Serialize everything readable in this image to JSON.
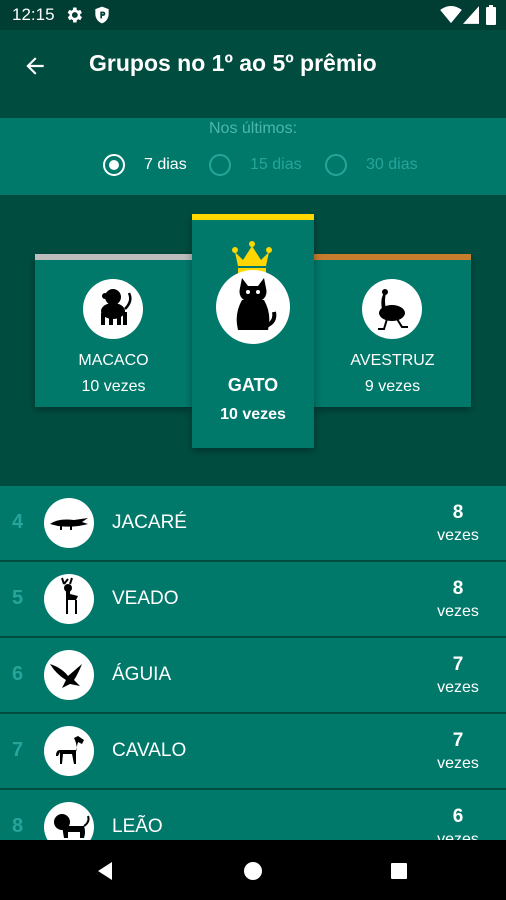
{
  "status": {
    "time": "12:15"
  },
  "header": {
    "title": "Grupos no 1º ao 5º prêmio"
  },
  "filter": {
    "label": "Nos últimos:",
    "options": [
      {
        "label": "7 dias",
        "selected": true
      },
      {
        "label": "15 dias",
        "selected": false
      },
      {
        "label": "30 dias",
        "selected": false
      }
    ]
  },
  "podium": {
    "first": {
      "name": "GATO",
      "count": "10 vezes",
      "icon": "cat-icon"
    },
    "second": {
      "name": "MACACO",
      "count": "10 vezes",
      "icon": "monkey-icon"
    },
    "third": {
      "name": "AVESTRUZ",
      "count": "9 vezes",
      "icon": "ostrich-icon"
    }
  },
  "list": [
    {
      "rank": "4",
      "name": "JACARÉ",
      "count": "8",
      "unit": "vezes",
      "icon": "alligator-icon"
    },
    {
      "rank": "5",
      "name": "VEADO",
      "count": "8",
      "unit": "vezes",
      "icon": "deer-icon"
    },
    {
      "rank": "6",
      "name": "ÁGUIA",
      "count": "7",
      "unit": "vezes",
      "icon": "eagle-icon"
    },
    {
      "rank": "7",
      "name": "CAVALO",
      "count": "7",
      "unit": "vezes",
      "icon": "horse-icon"
    },
    {
      "rank": "8",
      "name": "LEÃO",
      "count": "6",
      "unit": "vezes",
      "icon": "lion-icon"
    }
  ],
  "colors": {
    "primary_dark": "#004d40",
    "primary": "#00796b",
    "gold": "#ffd600",
    "silver": "#bdbdbd",
    "bronze": "#c77c2e"
  }
}
